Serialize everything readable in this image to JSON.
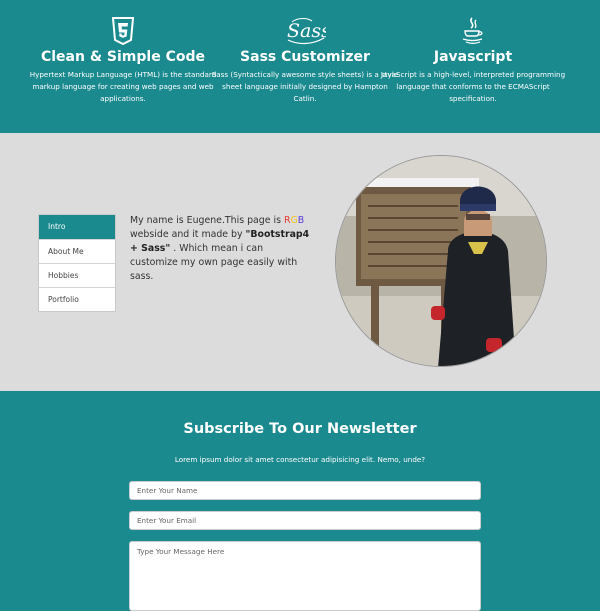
{
  "features": [
    {
      "icon": "html5-icon",
      "title": "Clean & Simple Code",
      "desc": "Hypertext Markup Language (HTML) is the standard markup language for creating web pages and web applications."
    },
    {
      "icon": "sass-logo-icon",
      "title": "Sass Customizer",
      "desc": "Sass (Syntactically awesome style sheets) is a style sheet language initially designed by Hampton Catlin."
    },
    {
      "icon": "java-cup-icon",
      "title": "Javascript",
      "desc": "JavaScript is a high-level, interpreted programming language that conforms to the ECMAScript specification."
    }
  ],
  "intro": {
    "tabs": [
      "Intro",
      "About Me",
      "Hobbies",
      "Portfolio"
    ],
    "active_tab": "Intro",
    "text": {
      "part1": "My name is Eugene.This page is ",
      "rgb": [
        "R",
        "G",
        "B"
      ],
      "part2": " webside and it made by ",
      "bold": "\"Bootstrap4 + Sass\"",
      "part3": " . Which mean i can customize my own page easily with sass."
    },
    "photo_alt": "profile-photo"
  },
  "newsletter": {
    "title": "Subscribe To Our Newsletter",
    "subtitle": "Lorem ipsum dolor sit amet consectetur adipisicing elit. Nemo, unde?",
    "name_placeholder": "Enter Your Name",
    "email_placeholder": "Enter Your Email",
    "message_placeholder": "Type Your Message Here"
  },
  "colors": {
    "accent": "#1b8a8f",
    "band_gray": "#dcdcdc"
  }
}
